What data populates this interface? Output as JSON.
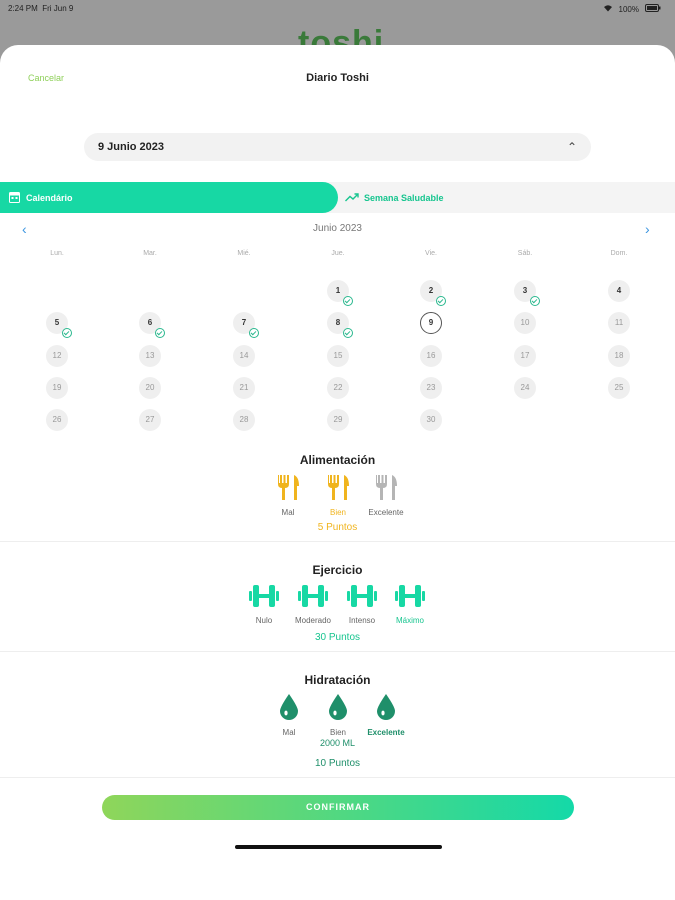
{
  "status": {
    "time": "2:24 PM",
    "date": "Fri Jun 9",
    "battery": "100%"
  },
  "background_logo": "toshi",
  "header": {
    "cancel": "Cancelar",
    "title": "Diario Toshi"
  },
  "date_picker": {
    "value": "9 Junio 2023"
  },
  "tabs": {
    "calendar": "Calendário",
    "week": "Semana Saludable"
  },
  "calendar": {
    "month": "Junio 2023",
    "weekdays": [
      "Lun.",
      "Mar.",
      "Mié.",
      "Jue.",
      "Vie.",
      "Sáb.",
      "Dom."
    ],
    "days": [
      "1",
      "2",
      "3",
      "4",
      "5",
      "6",
      "7",
      "8",
      "9",
      "10",
      "11",
      "12",
      "13",
      "14",
      "15",
      "16",
      "17",
      "18",
      "19",
      "20",
      "21",
      "22",
      "23",
      "24",
      "25",
      "26",
      "27",
      "28",
      "29",
      "30"
    ],
    "checked_days": [
      1,
      2,
      3,
      5,
      6,
      7,
      8
    ],
    "today": 9
  },
  "alimentacion": {
    "title": "Alimentación",
    "options": [
      "Mal",
      "Bien",
      "Excelente"
    ],
    "selected": 1,
    "points": "5 Puntos"
  },
  "ejercicio": {
    "title": "Ejercicio",
    "options": [
      "Nulo",
      "Moderado",
      "Intenso",
      "Máximo"
    ],
    "selected": 3,
    "points": "30 Puntos"
  },
  "hidratacion": {
    "title": "Hidratación",
    "options": [
      "Mal",
      "Bien",
      "Excelente"
    ],
    "selected": 2,
    "amount": "2000 ML",
    "points": "10 Puntos"
  },
  "confirm": "CONFIRMAR",
  "colors": {
    "accent": "#17d8a4",
    "food": "#f0b41e",
    "food_off": "#b5b5b5",
    "water": "#1f8f6a",
    "nav": "#3b95e0"
  }
}
